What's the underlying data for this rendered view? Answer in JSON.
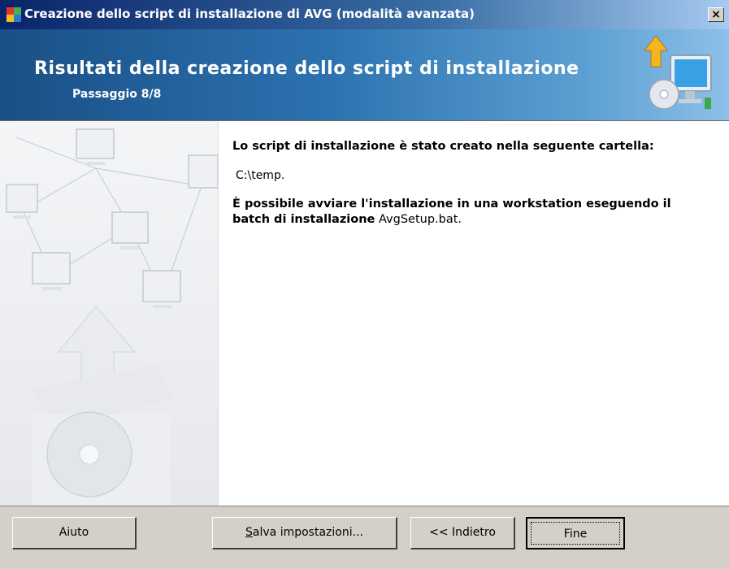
{
  "window": {
    "title": "Creazione dello script di installazione di AVG (modalità avanzata)",
    "close_label": "×"
  },
  "header": {
    "title": "Risultati della creazione dello script di installazione",
    "step": "Passaggio 8/8"
  },
  "main": {
    "created_line": "Lo script di installazione è stato creato nella seguente cartella:",
    "folder_path": "C:\\temp.",
    "info_bold": "È possibile avviare l'installazione in una workstation eseguendo il batch di installazione",
    "info_file": "AvgSetup.bat."
  },
  "buttons": {
    "help": "Aiuto",
    "save_underlined": "S",
    "save_rest": "alva impostazioni...",
    "back": "<< Indietro",
    "finish": "Fine"
  },
  "colors": {
    "banner_dark": "#1a4f86",
    "banner_light": "#8ec0e8",
    "title_bar": "#0a246a",
    "dialog_face": "#d4d0c8"
  }
}
